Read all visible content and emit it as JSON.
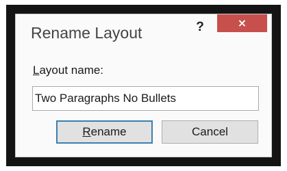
{
  "dialog": {
    "title": "Rename Layout",
    "help_icon": "question-mark-icon",
    "help_glyph": "?",
    "close_icon": "close-icon",
    "close_glyph": "×",
    "close_color": "#c7504d"
  },
  "form": {
    "label_accel": "L",
    "label_rest": "ayout name:",
    "layout_name_value": "Two Paragraphs No Bullets"
  },
  "buttons": {
    "rename_accel": "R",
    "rename_rest": "ename",
    "cancel_label": "Cancel"
  }
}
